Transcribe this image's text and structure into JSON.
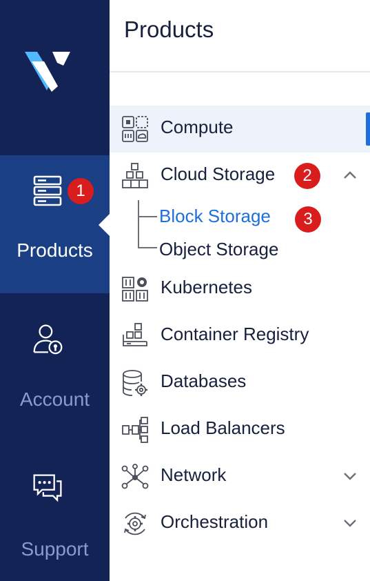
{
  "rail": {
    "items": [
      {
        "label": "Products",
        "icon": "server-stack-icon",
        "badge": "1",
        "active": true
      },
      {
        "label": "Account",
        "icon": "user-lock-icon",
        "active": false
      },
      {
        "label": "Support",
        "icon": "chat-bubbles-icon",
        "active": false
      }
    ]
  },
  "panel": {
    "title": "Products",
    "menu": [
      {
        "label": "Compute",
        "icon": "compute-icon",
        "selected": true
      },
      {
        "label": "Cloud Storage",
        "icon": "cloud-storage-icon",
        "badge": "2",
        "expanded": true,
        "children": [
          {
            "label": "Block Storage",
            "badge": "3",
            "active": true
          },
          {
            "label": "Object Storage",
            "active": false
          }
        ]
      },
      {
        "label": "Kubernetes",
        "icon": "kubernetes-icon"
      },
      {
        "label": "Container Registry",
        "icon": "container-registry-icon"
      },
      {
        "label": "Databases",
        "icon": "database-gear-icon"
      },
      {
        "label": "Load Balancers",
        "icon": "load-balancer-icon"
      },
      {
        "label": "Network",
        "icon": "network-nodes-icon",
        "expandable": true
      },
      {
        "label": "Orchestration",
        "icon": "orchestration-gear-icon",
        "expandable": true
      }
    ]
  },
  "colors": {
    "rail_bg": "#142355",
    "rail_active_bg": "#1a3f85",
    "accent": "#1e6fd9",
    "badge": "#d91d1d",
    "selected_row_bg": "#eef2fb"
  }
}
